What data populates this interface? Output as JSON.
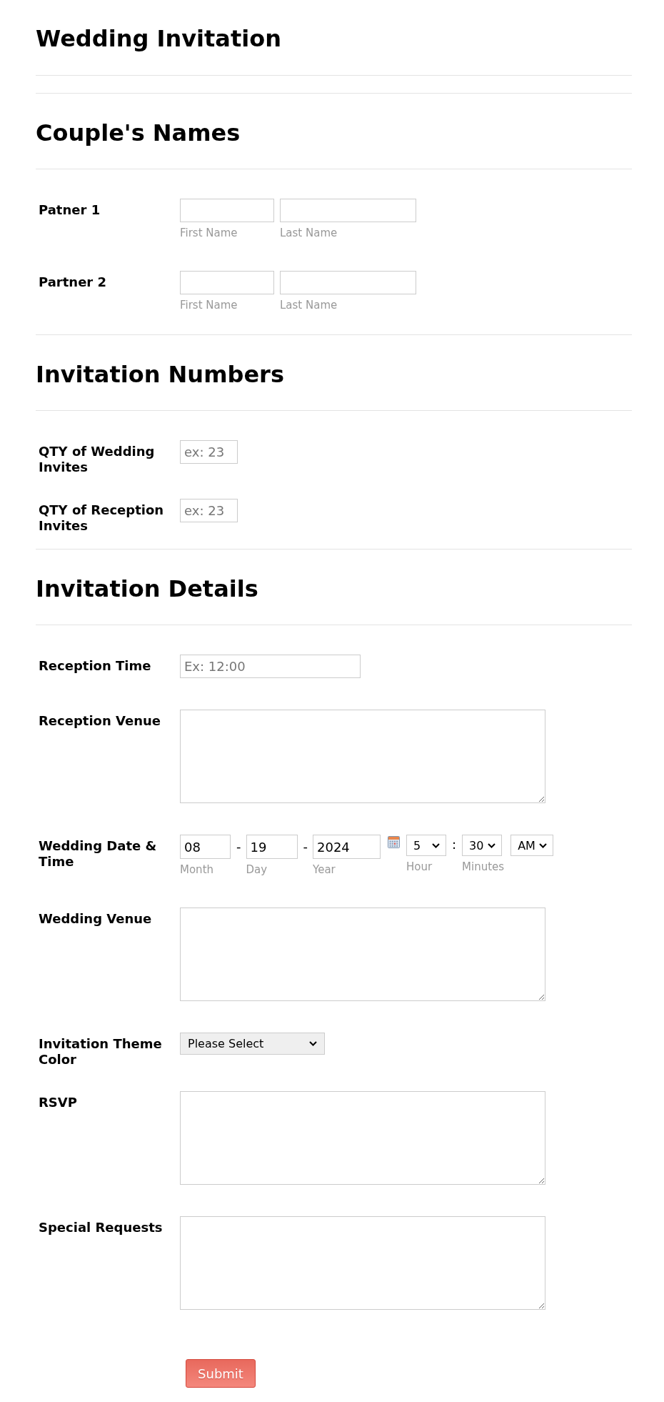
{
  "form_title": "Wedding Invitation",
  "sections": [
    {
      "heading": "Couple's Names",
      "questions": [
        {
          "kind": "name",
          "label": "Patner 1",
          "fields": [
            {
              "sublabel": "First Name"
            },
            {
              "sublabel": "Last Name"
            }
          ]
        },
        {
          "kind": "name",
          "label": "Partner 2",
          "fields": [
            {
              "sublabel": "First Name"
            },
            {
              "sublabel": "Last Name"
            }
          ]
        }
      ]
    },
    {
      "heading": "Invitation Numbers",
      "questions": [
        {
          "kind": "number",
          "label": "QTY of Wedding Invites",
          "placeholder": "ex: 23"
        },
        {
          "kind": "number",
          "label": "QTY of Reception Invites",
          "placeholder": "ex: 23"
        }
      ]
    },
    {
      "heading": "Invitation Details",
      "questions": [
        {
          "kind": "text",
          "label": "Reception Time",
          "placeholder": "Ex: 12:00"
        },
        {
          "kind": "textarea",
          "label": "Reception Venue"
        },
        {
          "kind": "datetime",
          "label": "Wedding Date & Time",
          "date_parts": [
            {
              "kind": "input",
              "value": "08",
              "sublabel": "Month"
            },
            {
              "kind": "separator",
              "text": "-"
            },
            {
              "kind": "input",
              "value": "19",
              "sublabel": "Day"
            },
            {
              "kind": "separator",
              "text": "-"
            },
            {
              "kind": "input",
              "value": "2024",
              "sublabel": "Year"
            }
          ],
          "time_parts": [
            {
              "kind": "select",
              "value": "5",
              "sublabel": "Hour"
            },
            {
              "kind": "separator",
              "text": ":"
            },
            {
              "kind": "select",
              "value": "30",
              "sublabel": "Minutes"
            },
            {
              "kind": "select",
              "value": "AM"
            }
          ]
        },
        {
          "kind": "textarea",
          "label": "Wedding Venue"
        },
        {
          "kind": "dropdown",
          "label": "Invitation Theme Color",
          "value": "Please Select"
        },
        {
          "kind": "textarea",
          "label": "RSVP"
        },
        {
          "kind": "textarea",
          "label": "Special Requests"
        }
      ]
    }
  ],
  "submit_button": "Submit"
}
